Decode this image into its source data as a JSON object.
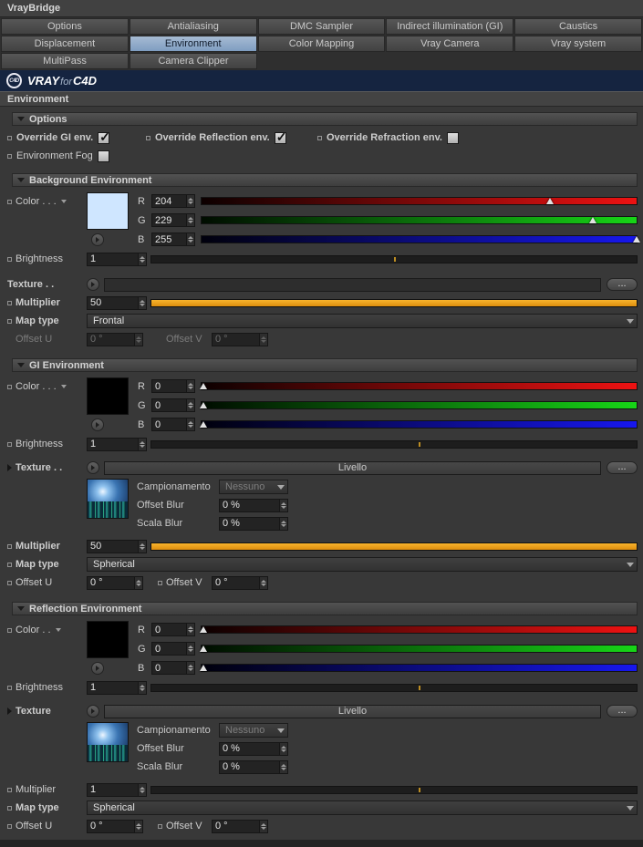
{
  "window": {
    "title": "VrayBridge"
  },
  "tabs": {
    "row1": [
      "Options",
      "Antialiasing",
      "DMC Sampler",
      "Indirect illumination (GI)",
      "Caustics"
    ],
    "row2": [
      "Displacement",
      "Environment",
      "Color Mapping",
      "Vray Camera",
      "Vray system"
    ],
    "row3": [
      "MultiPass",
      "Camera Clipper"
    ],
    "selected": "Environment"
  },
  "logo": {
    "badge": "C4D",
    "vray": "VRAY",
    "for": "for",
    "c4d": "C4D"
  },
  "page_title": "Environment",
  "colors": {
    "accent_orange": "#f2a71f",
    "tab_selected": "#8ea9c9",
    "bg_swatch": "#cfe6ff",
    "gi_swatch": "#000000",
    "refl_swatch": "#000000"
  },
  "options": {
    "header": "Options",
    "override_gi": {
      "label": "Override GI env.",
      "checked": true
    },
    "override_reflection": {
      "label": "Override Reflection env.",
      "checked": true
    },
    "override_refraction": {
      "label": "Override Refraction env.",
      "checked": false
    },
    "environment_fog": {
      "label": "Environment Fog",
      "checked": false
    }
  },
  "bg": {
    "title": "Background Environment",
    "color_label": "Color . . .",
    "r_label": "R",
    "g_label": "G",
    "b_label": "B",
    "r": "204",
    "g": "229",
    "b": "255",
    "brightness_label": "Brightness",
    "brightness": "1",
    "texture_label": "Texture . .",
    "texture_value": "",
    "more_label": "...",
    "multiplier_label": "Multiplier",
    "multiplier": "50",
    "maptype_label": "Map type",
    "maptype": "Frontal",
    "offsetu_label": "Offset U",
    "offsetu": "0 °",
    "offsetv_label": "Offset V",
    "offsetv": "0 °"
  },
  "gi": {
    "title": "GI Environment",
    "color_label": "Color . . .",
    "r_label": "R",
    "g_label": "G",
    "b_label": "B",
    "r": "0",
    "g": "0",
    "b": "0",
    "brightness_label": "Brightness",
    "brightness": "1",
    "texture_label": "Texture . .",
    "texture_value": "Livello",
    "more_label": "...",
    "sampling_label": "Campionamento",
    "sampling_value": "Nessuno",
    "offsetblur_label": "Offset Blur",
    "offsetblur": "0 %",
    "scalablur_label": "Scala Blur",
    "scalablur": "0 %",
    "multiplier_label": "Multiplier",
    "multiplier": "50",
    "maptype_label": "Map type",
    "maptype": "Spherical",
    "offsetu_label": "Offset U",
    "offsetu": "0 °",
    "offsetv_label": "Offset V",
    "offsetv": "0 °"
  },
  "refl": {
    "title": "Reflection Environment",
    "color_label": "Color . .",
    "r_label": "R",
    "g_label": "G",
    "b_label": "B",
    "r": "0",
    "g": "0",
    "b": "0",
    "brightness_label": "Brightness",
    "brightness": "1",
    "texture_label": "Texture",
    "texture_value": "Livello",
    "more_label": "...",
    "sampling_label": "Campionamento",
    "sampling_value": "Nessuno",
    "offsetblur_label": "Offset Blur",
    "offsetblur": "0 %",
    "scalablur_label": "Scala Blur",
    "scalablur": "0 %",
    "multiplier_label": "Multiplier",
    "multiplier": "1",
    "maptype_label": "Map type",
    "maptype": "Spherical",
    "offsetu_label": "Offset U",
    "offsetu": "0 °",
    "offsetv_label": "Offset V",
    "offsetv": "0 °"
  }
}
